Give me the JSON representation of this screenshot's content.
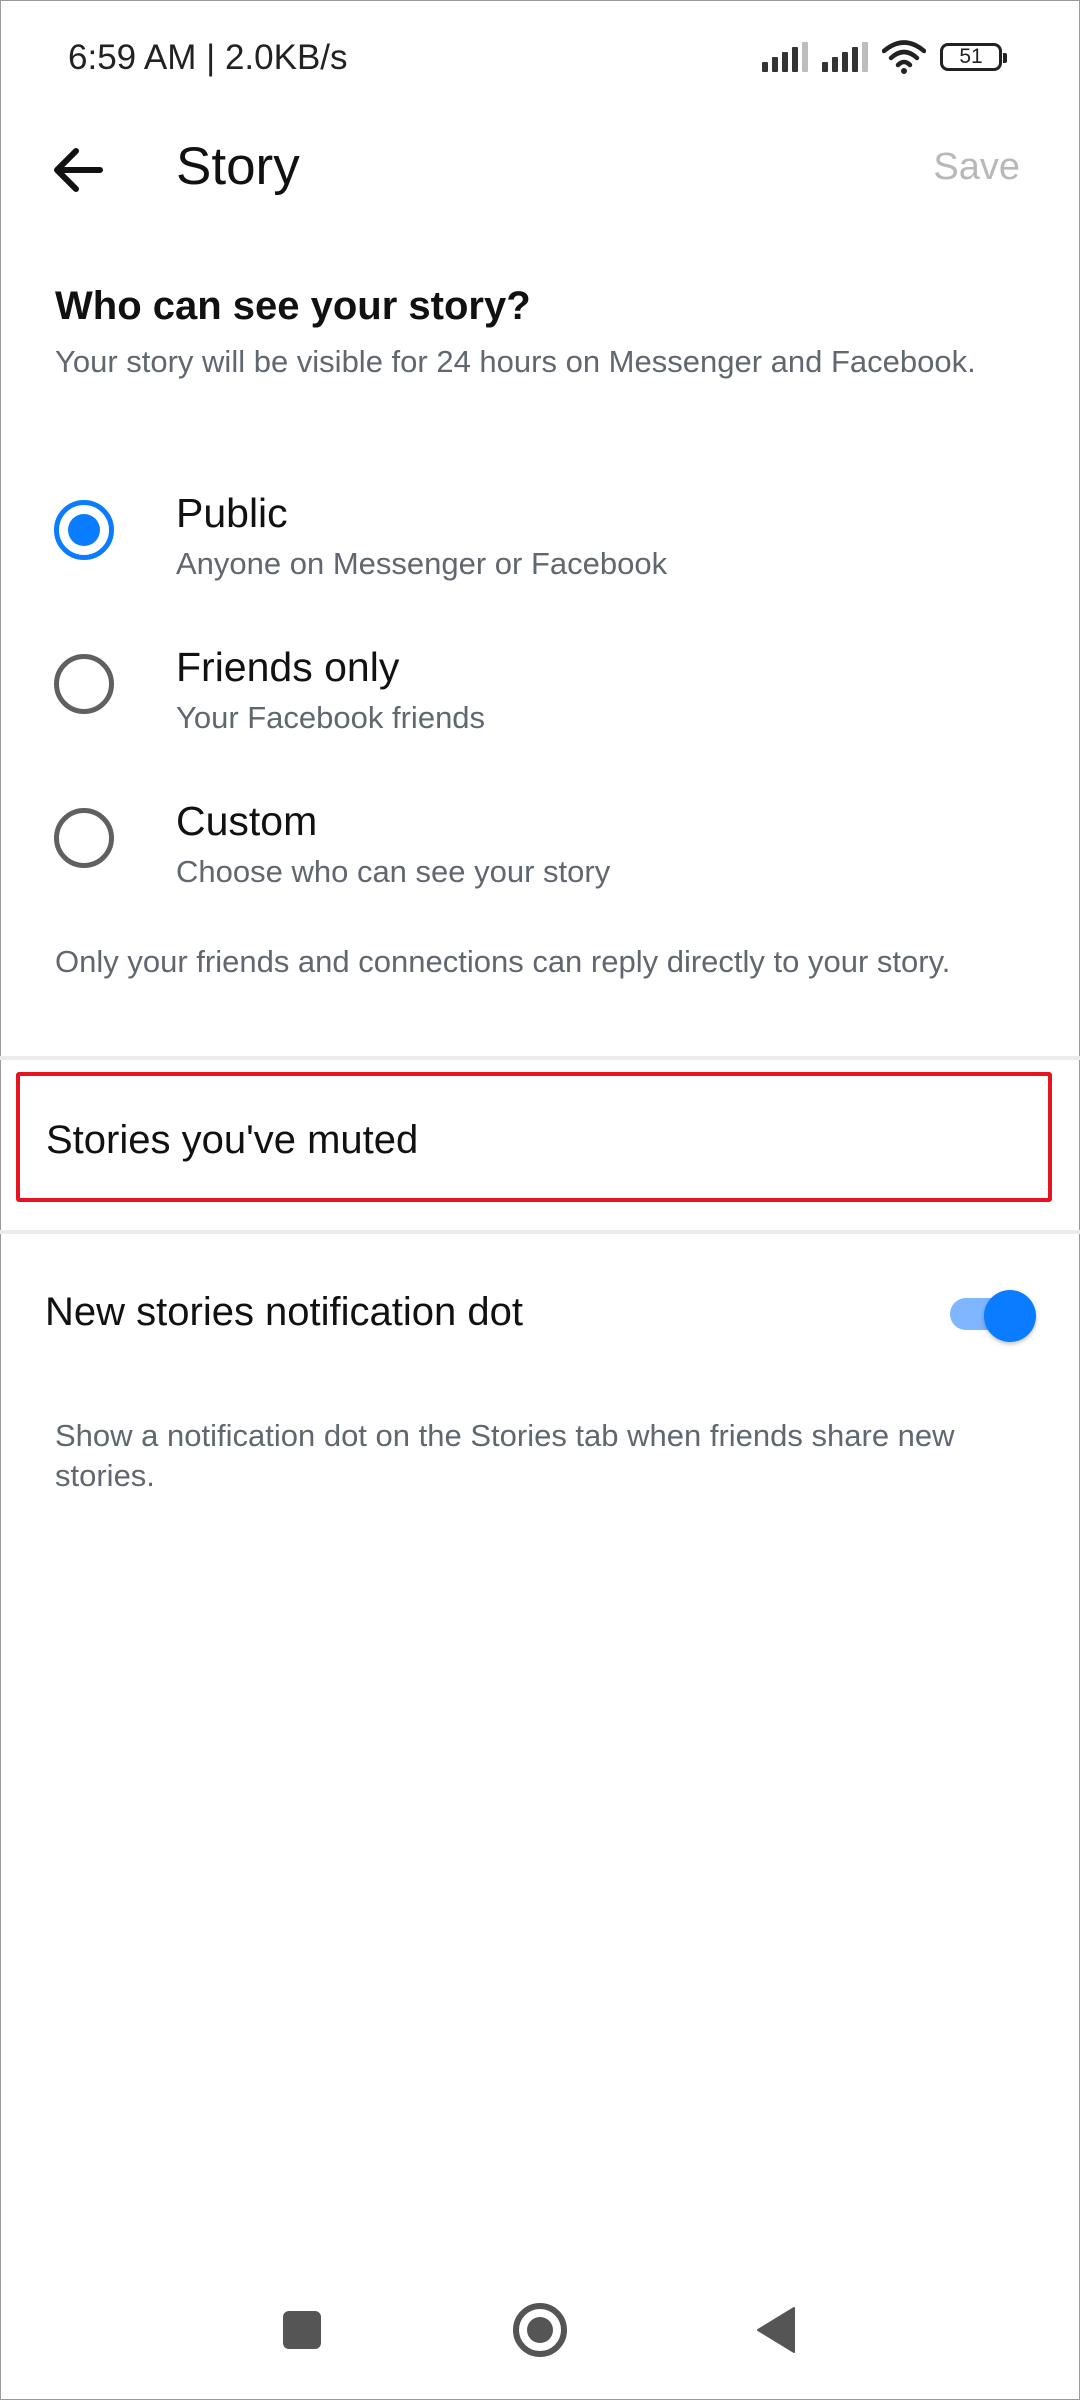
{
  "status_bar": {
    "time_speed": "6:59 AM | 2.0KB/s",
    "battery": "51"
  },
  "header": {
    "title": "Story",
    "save_label": "Save"
  },
  "visibility": {
    "question": "Who can see your story?",
    "description": "Your story will be visible for 24 hours on Messenger and Facebook.",
    "options": [
      {
        "label": "Public",
        "sublabel": "Anyone on Messenger or Facebook",
        "selected": true
      },
      {
        "label": "Friends only",
        "sublabel": "Your Facebook friends",
        "selected": false
      },
      {
        "label": "Custom",
        "sublabel": "Choose who can see your story",
        "selected": false
      }
    ],
    "reply_note": "Only your friends and connections can reply directly to your story."
  },
  "muted": {
    "label": "Stories you've muted"
  },
  "notification_dot": {
    "label": "New stories notification dot",
    "enabled": true,
    "description": "Show a notification dot on the Stories tab when friends share new stories."
  },
  "colors": {
    "accent": "#0a7cff",
    "highlight_border": "#e5141e",
    "secondary_text": "#606770"
  },
  "nav_bar": {
    "icons": [
      "recents-square-icon",
      "home-circle-icon",
      "back-triangle-icon"
    ]
  }
}
